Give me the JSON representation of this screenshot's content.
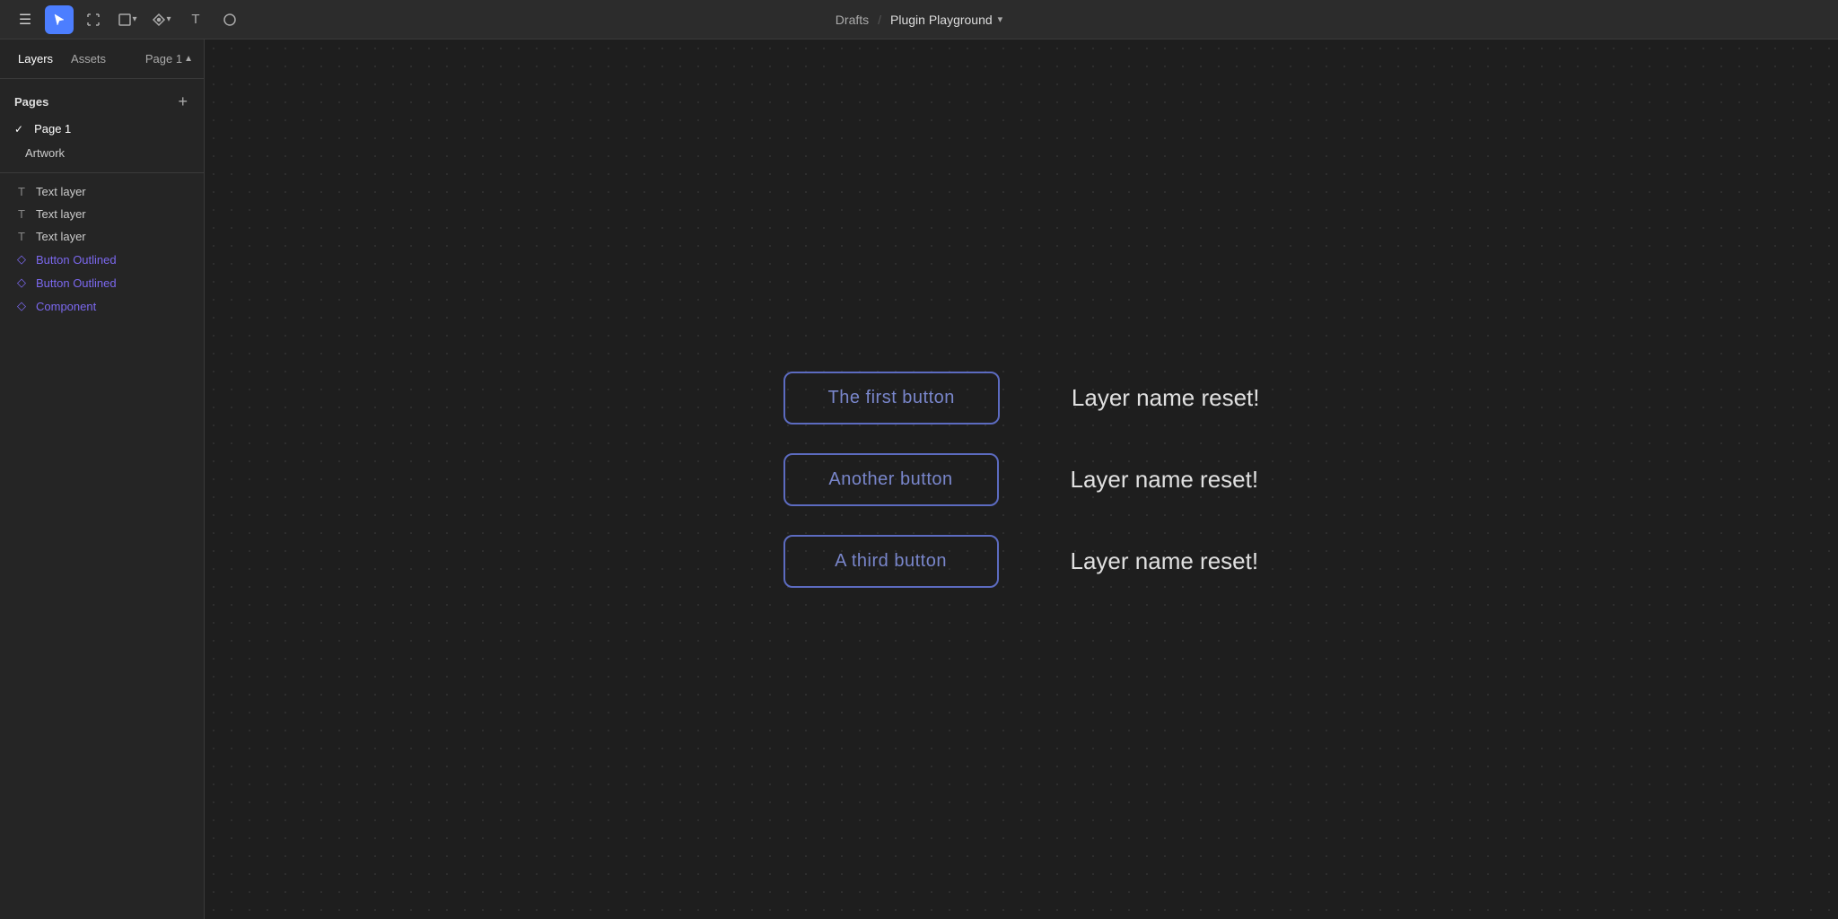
{
  "toolbar": {
    "breadcrumb_drafts": "Drafts",
    "breadcrumb_separator": "/",
    "project_name": "Plugin Playground",
    "chevron": "▾",
    "tools": [
      {
        "name": "menu-icon",
        "icon": "☰",
        "active": false
      },
      {
        "name": "select-tool",
        "icon": "↖",
        "active": true
      },
      {
        "name": "frame-tool",
        "icon": "#",
        "active": false
      },
      {
        "name": "shape-tool",
        "icon": "□",
        "active": false
      },
      {
        "name": "pen-tool",
        "icon": "✒",
        "active": false
      },
      {
        "name": "text-tool",
        "icon": "T",
        "active": false
      },
      {
        "name": "comment-tool",
        "icon": "○",
        "active": false
      }
    ]
  },
  "sidebar": {
    "tabs": [
      {
        "id": "layers",
        "label": "Layers",
        "active": true
      },
      {
        "id": "assets",
        "label": "Assets",
        "active": false
      }
    ],
    "page_indicator": "Page 1",
    "pages_section_label": "Pages",
    "add_page_label": "+",
    "pages": [
      {
        "id": "page1",
        "label": "Page 1",
        "active": true
      },
      {
        "id": "artwork",
        "label": "Artwork",
        "active": false
      }
    ],
    "layers": [
      {
        "type": "text",
        "name": "Text layer",
        "icon": "T"
      },
      {
        "type": "text",
        "name": "Text layer",
        "icon": "T"
      },
      {
        "type": "text",
        "name": "Text layer",
        "icon": "T"
      },
      {
        "type": "component",
        "name": "Button Outlined",
        "icon": "◇"
      },
      {
        "type": "component",
        "name": "Button Outlined",
        "icon": "◇"
      },
      {
        "type": "component",
        "name": "Component",
        "icon": "◇"
      }
    ]
  },
  "canvas": {
    "rows": [
      {
        "button_label": "The first button",
        "status_label": "Layer name reset!"
      },
      {
        "button_label": "Another button",
        "status_label": "Layer name reset!"
      },
      {
        "button_label": "A third button",
        "status_label": "Layer name reset!"
      }
    ]
  }
}
